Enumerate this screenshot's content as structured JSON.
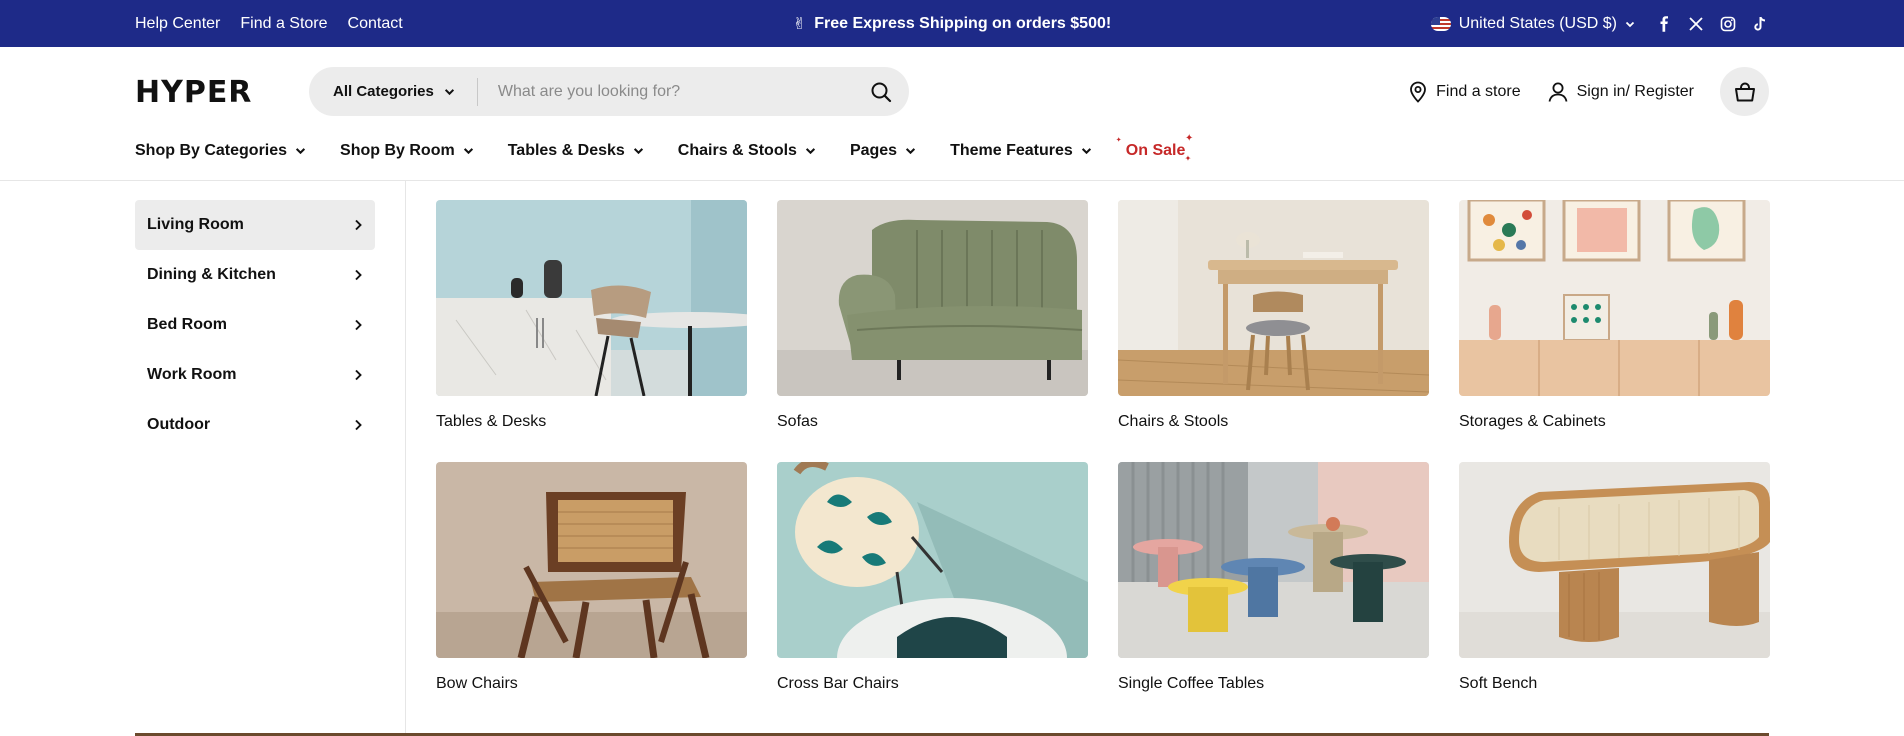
{
  "announcement": {
    "links": [
      "Help Center",
      "Find a Store",
      "Contact"
    ],
    "promo_emoji": "✌",
    "promo_text": "Free Express Shipping on orders $500!",
    "country": "United States (USD $)"
  },
  "header": {
    "logo": "HYPER",
    "search": {
      "category": "All Categories",
      "placeholder": "What are you looking for?"
    },
    "find_store": "Find a store",
    "sign_in": "Sign in/ Register"
  },
  "nav": {
    "items": [
      "Shop By Categories",
      "Shop By Room",
      "Tables & Desks",
      "Chairs & Stools",
      "Pages",
      "Theme Features"
    ],
    "sale": "On Sale"
  },
  "sidebar": {
    "items": [
      "Living Room",
      "Dining & Kitchen",
      "Bed Room",
      "Work Room",
      "Outdoor"
    ]
  },
  "products": [
    "Tables & Desks",
    "Sofas",
    "Chairs & Stools",
    "Storages & Cabinets",
    "Bow Chairs",
    "Cross Bar Chairs",
    "Single Coffee Tables",
    "Soft Bench"
  ],
  "colors": {
    "topbar_bg": "#1e2a88",
    "sale_red": "#c62828",
    "search_bg": "#ececec",
    "active_bg": "#ececec"
  },
  "icons": [
    "chevron-down-icon",
    "facebook-icon",
    "x-icon",
    "instagram-icon",
    "tiktok-icon",
    "search-icon",
    "location-pin-icon",
    "user-icon",
    "shopping-bag-icon",
    "chevron-right-icon"
  ]
}
